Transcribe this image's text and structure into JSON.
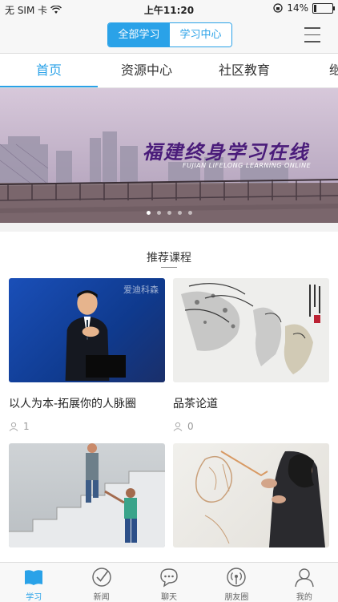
{
  "status_bar": {
    "carrier": "无 SIM 卡",
    "time": "上午11:20",
    "battery": "14%"
  },
  "header": {
    "segments": [
      "全部学习",
      "学习中心"
    ],
    "active_segment": 0
  },
  "tabs": [
    {
      "label": "首页"
    },
    {
      "label": "资源中心"
    },
    {
      "label": "社区教育"
    },
    {
      "label": "继续"
    }
  ],
  "banner": {
    "title": "福建终身学习在线",
    "subtitle": "FUJIAN LIFELONG LEARNING ONLINE"
  },
  "recommended": {
    "section_title": "推荐课程",
    "courses": [
      {
        "title": "以人为本-拓展你的人脉圈",
        "views": "1",
        "thumb_text": "爱迪科森"
      },
      {
        "title": "品茶论道",
        "views": "0"
      },
      {
        "title": "",
        "views": ""
      },
      {
        "title": "",
        "views": ""
      }
    ]
  },
  "bottom_nav": [
    {
      "label": "学习",
      "icon": "book-icon"
    },
    {
      "label": "新闻",
      "icon": "check-circle-icon"
    },
    {
      "label": "聊天",
      "icon": "chat-bubble-icon"
    },
    {
      "label": "朋友圈",
      "icon": "broadcast-icon"
    },
    {
      "label": "我的",
      "icon": "person-icon"
    }
  ],
  "colors": {
    "accent": "#2aa2e8"
  }
}
